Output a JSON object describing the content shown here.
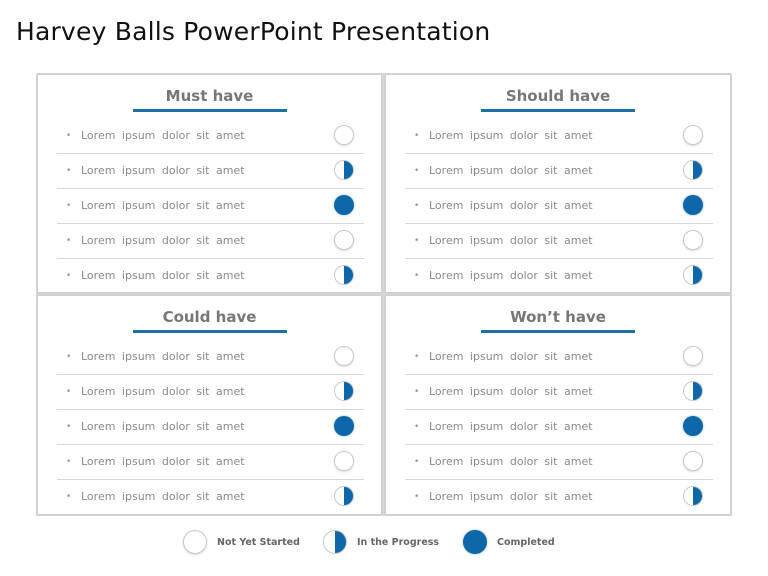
{
  "title": "Harvey Balls PowerPoint Presentation",
  "colors": {
    "accent": "#0d67a8",
    "underline": "#1f6fa3",
    "heading": "#777777",
    "text": "#8a8a8a"
  },
  "panels": [
    {
      "heading": "Must have",
      "items": [
        {
          "text": "Lorem  ipsum  dolor  sit amet",
          "status": "none"
        },
        {
          "text": "Lorem  ipsum  dolor  sit amet",
          "status": "half"
        },
        {
          "text": "Lorem  ipsum  dolor  sit amet",
          "status": "full"
        },
        {
          "text": "Lorem  ipsum  dolor  sit amet",
          "status": "none"
        },
        {
          "text": "Lorem  ipsum  dolor  sit amet",
          "status": "half"
        }
      ]
    },
    {
      "heading": "Should have",
      "items": [
        {
          "text": "Lorem  ipsum  dolor  sit amet",
          "status": "none"
        },
        {
          "text": "Lorem  ipsum  dolor  sit amet",
          "status": "half"
        },
        {
          "text": "Lorem  ipsum  dolor  sit amet",
          "status": "full"
        },
        {
          "text": "Lorem  ipsum  dolor  sit amet",
          "status": "none"
        },
        {
          "text": "Lorem  ipsum  dolor  sit amet",
          "status": "half"
        }
      ]
    },
    {
      "heading": "Could have",
      "items": [
        {
          "text": "Lorem  ipsum  dolor  sit amet",
          "status": "none"
        },
        {
          "text": "Lorem  ipsum  dolor  sit amet",
          "status": "half"
        },
        {
          "text": "Lorem  ipsum  dolor  sit amet",
          "status": "full"
        },
        {
          "text": "Lorem  ipsum  dolor  sit amet",
          "status": "none"
        },
        {
          "text": "Lorem  ipsum  dolor  sit amet",
          "status": "half"
        }
      ]
    },
    {
      "heading": "Won’t have",
      "items": [
        {
          "text": "Lorem  ipsum  dolor  sit amet",
          "status": "none"
        },
        {
          "text": "Lorem  ipsum  dolor  sit amet",
          "status": "half"
        },
        {
          "text": "Lorem  ipsum  dolor  sit amet",
          "status": "full"
        },
        {
          "text": "Lorem  ipsum  dolor  sit amet",
          "status": "none"
        },
        {
          "text": "Lorem  ipsum  dolor  sit amet",
          "status": "half"
        }
      ]
    }
  ],
  "legend": [
    {
      "label": "Not Yet Started",
      "status": "none"
    },
    {
      "label": "In the Progress",
      "status": "half"
    },
    {
      "label": "Completed",
      "status": "full"
    }
  ]
}
